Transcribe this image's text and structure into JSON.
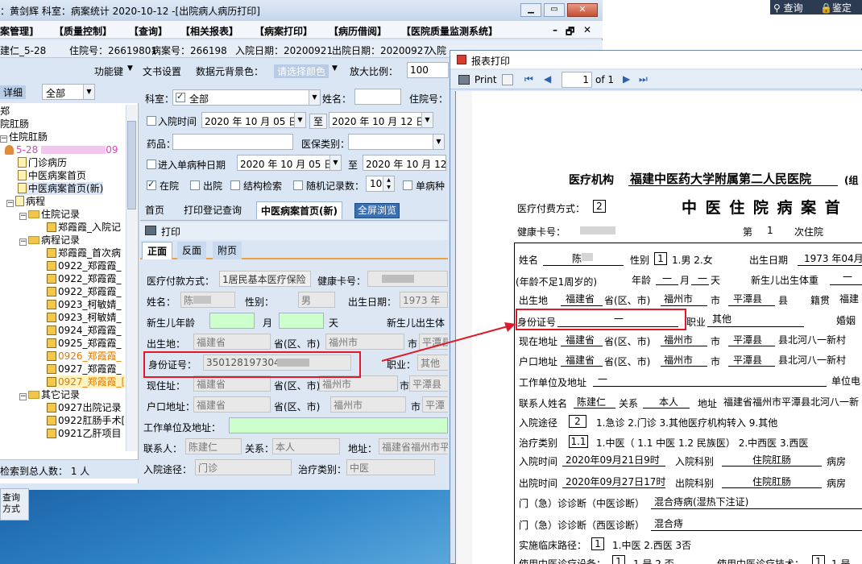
{
  "left_window": {
    "title": "：黄剑辉  科室：病案统计  2020-10-12  -[出院病人病历打印]",
    "menu": [
      "案管理]",
      "【质量控制】",
      "【查询】",
      "【相关报表】",
      "【病案打印】",
      "【病历借阅】",
      "【医院质量监测系统】"
    ],
    "info": {
      "prefix": "建仁_5-28",
      "inpatient_no": "住院号：26619801",
      "record_no": "病案号：266198",
      "admit_date": "入院日期：20200921",
      "discharge_date": "出院日期：20200927",
      "more": "入院"
    },
    "toolbar": {
      "func_key": "功能键",
      "doc_print": "文书设置",
      "bg_color": "数据元背景色：",
      "color_placeholder": "请选择颜色",
      "zoom_label": "放大比例：",
      "zoom_value": "100"
    },
    "left_tabs": {
      "detail": "详细",
      "all": "全部"
    },
    "tree": {
      "items": [
        "郑",
        "院肛肠",
        "住院肛肠",
        "5-28",
        "门诊病历",
        "中医病案首页",
        "中医病案首页(新)",
        "病程",
        "住院记录",
        "郑霞霞_入院记",
        "病程记录",
        "郑霞霞_首次病",
        "0922_郑霞霞_",
        "0922_郑霞霞_",
        "0922_郑霞霞_",
        "0923_柯敏婧_",
        "0923_柯敏婧_",
        "0924_郑霞霞_",
        "0925_郑霞霞_",
        "0926_郑霞霞_",
        "0927_郑霞霞_",
        "0927_郑霞霞_[",
        "其它记录",
        "0927出院记录",
        "0922肛肠手术[",
        "0921乙肝项目"
      ]
    },
    "search_count": "检索到总人数：  1  人",
    "filter": {
      "dept_label": "科室：",
      "dept_value": "全部",
      "name_label": "姓名：",
      "inpatient_label": "住院号：",
      "admit_time": "入院时间",
      "date1": "2020 年 10 月 05 日",
      "to": "至",
      "date2": "2020 年 10 月 12 日",
      "drug": "药品：",
      "insurance": "医保类别：",
      "admit_type_date": "进入单病种日期",
      "date3": "2020 年 10 月 05 日",
      "date4": "2020 年 10 月 12",
      "in_hospital": "在院",
      "out_hospital": "出院",
      "struct_search": "结构检索",
      "random_count": "随机记录数：",
      "random_value": "10",
      "single_disease": "单病种"
    },
    "sub_tabs": [
      "首页",
      "打印登记查询",
      "中医病案首页(新)",
      "全屏浏览"
    ],
    "print_label": "打印",
    "form_tabs": [
      "正面",
      "反面",
      "附页"
    ],
    "form": {
      "pay_label": "医疗付款方式：",
      "pay_value": "1居民基本医疗保险",
      "health_card": "健康卡号：",
      "name_label": "姓名：",
      "name_value": "陈",
      "sex_label": "性别：",
      "sex_value": "男",
      "birth_label": "出生日期：",
      "birth_value": "1973 年",
      "newborn_age": "新生儿年龄",
      "month": "月",
      "day": "天",
      "newborn_weight": "新生儿出生体",
      "birthplace_label": "出生地：",
      "birthplace_prov": "福建省",
      "prov_city": "省(区、市)",
      "birthplace_city": "福州市",
      "city": "市",
      "birthplace_county": "平潭县",
      "id_label": "身份证号：",
      "id_value": "350128197304",
      "occupation": "职业：",
      "occupation_value": "其他",
      "addr_label": "现住址：",
      "addr_prov": "福建省",
      "addr_city": "福州市",
      "addr_county": "平潭县",
      "hukou_label": "户口地址：",
      "hukou_prov": "福建省",
      "hukou_city": "福州市",
      "hukou_county": "平潭",
      "work_label": "工作单位及地址：",
      "contact_label": "联系人：",
      "contact_value": "陈建仁",
      "relation_label": "关系：",
      "relation_value": "本人",
      "address_label": "地址：",
      "address_value": "福建省福州市平",
      "admit_path": "入院途径：",
      "admit_path_value": "门诊",
      "treat_type": "治疗类别：",
      "treat_type_value": "中医"
    }
  },
  "top_right": {
    "query": "查询",
    "lock": "鉴定"
  },
  "report_window": {
    "title": "报表打印",
    "toolbar": {
      "print": "Print",
      "page": "1",
      "of": "of 1"
    },
    "doc": {
      "org_label": "医疗机构",
      "org_name": "福建中医药大学附属第二人民医院",
      "org_code": "(组",
      "pay_label": "医疗付费方式：",
      "pay_value": "2",
      "title": "中 医 住 院 病 案 首",
      "health_card": "健康卡号：",
      "times_prefix": "第",
      "times_value": "1",
      "times_suffix": "次住院",
      "name_label": "姓名",
      "name_value": "陈",
      "sex_label": "性别",
      "sex_value": "1",
      "sex_opts": "1.男 2.女",
      "birth_label": "出生日期",
      "birth_value": "1973 年04月",
      "age_note": "(年龄不足1周岁的)",
      "age_label": "年龄",
      "age_month": "一",
      "month": "月",
      "age_day": "一",
      "day": "天",
      "newborn_weight": "新生儿出生体重",
      "newborn_weight_value": "一",
      "birthplace_label": "出生地",
      "bp_prov": "福建省",
      "prov": "省(区、市)",
      "bp_city": "福州市",
      "city": "市",
      "bp_county": "平潭县",
      "county": "县",
      "native_label": "籍贯",
      "native_value": "福建",
      "id_label": "身份证号",
      "id_value": "一",
      "occupation_label": "职业",
      "occupation_value": "其他",
      "marriage": "婚姻",
      "curaddr_label": "现在地址",
      "cur_prov": "福建省",
      "cur_city": "福州市",
      "cur_county": "平潭县",
      "cur_county_more": "县北河八一新村",
      "hukou_label": "户口地址",
      "hk_prov": "福建省",
      "hk_city": "福州市",
      "hk_county": "平潭县",
      "hk_county_more": "县北河八一新村",
      "work_label": "工作单位及地址",
      "work_value": "一",
      "work_phone": "单位电",
      "contact_label": "联系人姓名",
      "contact_value": "陈建仁",
      "relation_label": "关系",
      "relation_value": "本人",
      "address_label": "地址",
      "address_value": "福建省福州市平潭县北河八一新",
      "admit_path_label": "入院途径",
      "admit_path_value": "2",
      "admit_path_opts": "1.急诊  2.门诊  3.其他医疗机构转入  9.其他",
      "treat_label": "治疗类别",
      "treat_value": "1.1",
      "treat_opts": "1.中医（ 1.1 中医  1.2 民族医） 2.中西医  3.西医",
      "admit_time_label": "入院时间",
      "admit_time_value": "2020年09月21日9时",
      "admit_dept_label": "入院科别",
      "admit_dept_value": "住院肛肠",
      "ward1": "病房",
      "out_time_label": "出院时间",
      "out_time_value": "2020年09月27日17时",
      "out_dept_label": "出院科别",
      "out_dept_value": "住院肛肠",
      "ward2": "病房",
      "tcm_diag_label": "门（急）诊诊断（中医诊断）",
      "tcm_diag_value": "混合痔病(湿热下注证)",
      "wm_diag_label": "门（急）诊诊断（西医诊断）",
      "wm_diag_value": "混合痔",
      "pathway_label": "实施临床路径：",
      "pathway_value": "1",
      "pathway_opts": "1.中医    2.西医      3否",
      "device_label": "使用中医诊疗设备：",
      "device_value": "1",
      "device_opts": "1.是    2.否",
      "tech_label": "使用中医诊疗技术：",
      "tech_value": "1",
      "tech_opts": "1.是"
    }
  }
}
